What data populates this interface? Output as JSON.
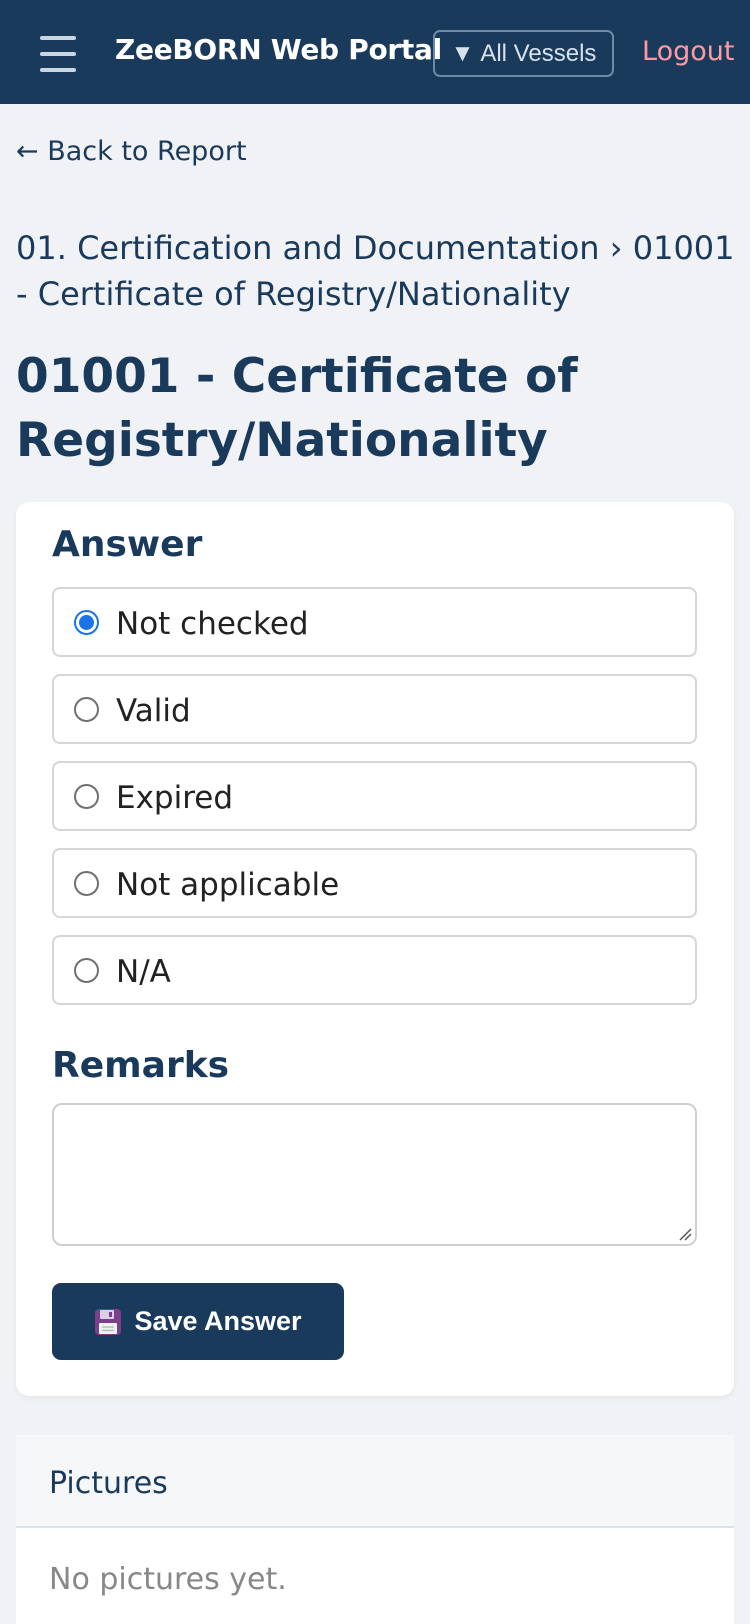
{
  "navbar": {
    "brand": "ZeeBORN Web Portal",
    "vessel_selector": "All Vessels",
    "vessel_selector_icon": "▼",
    "logout": "Logout"
  },
  "back_link": "← Back to Report",
  "breadcrumb": "01. Certification and Documentation › 01001 - Certificate of Registry/Nationality",
  "page_title": "01001 - Certificate of Registry/Nationality",
  "answer": {
    "label": "Answer",
    "options": [
      {
        "label": "Not checked",
        "selected": true
      },
      {
        "label": "Valid",
        "selected": false
      },
      {
        "label": "Expired",
        "selected": false
      },
      {
        "label": "Not applicable",
        "selected": false
      },
      {
        "label": "N/A",
        "selected": false
      }
    ]
  },
  "remarks": {
    "label": "Remarks",
    "value": ""
  },
  "save_button": {
    "label": "Save Answer",
    "icon": "floppy-disk-icon"
  },
  "pictures": {
    "title": "Pictures",
    "empty_text": "No pictures yet."
  },
  "colors": {
    "navbar": "#1a3a5c",
    "accent": "#1a73e8",
    "logout": "#ff9aa2",
    "background": "#f0f2f5"
  }
}
